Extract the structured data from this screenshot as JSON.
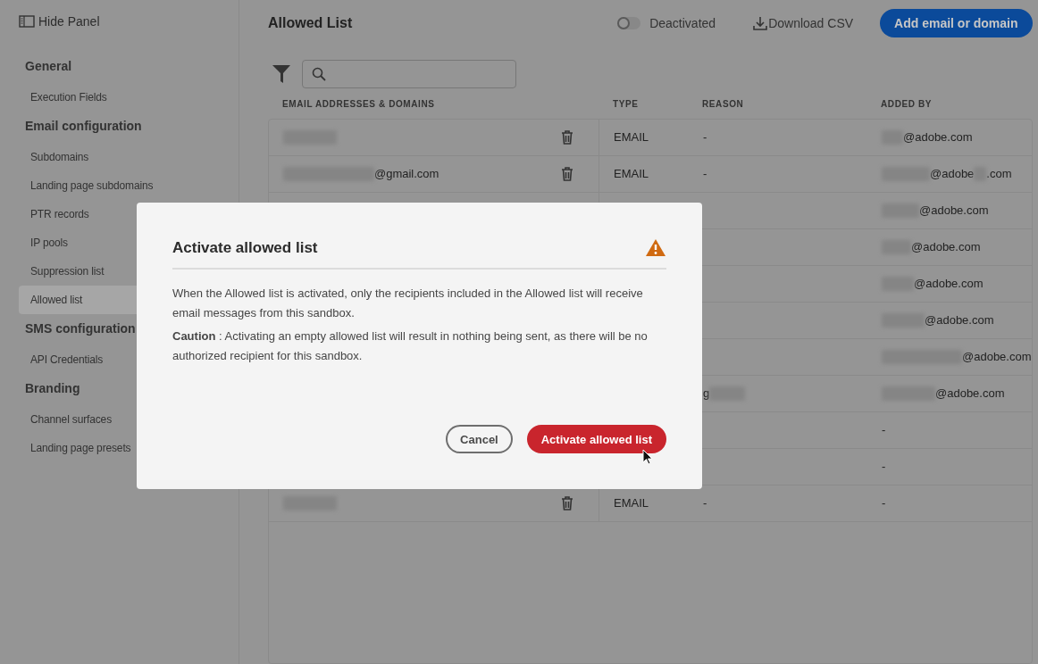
{
  "sidebar": {
    "toggle_label": "Hide Panel",
    "sections": [
      {
        "title": "General",
        "items": [
          {
            "label": "Execution Fields",
            "selected": false
          }
        ]
      },
      {
        "title": "Email configuration",
        "items": [
          {
            "label": "Subdomains",
            "selected": false
          },
          {
            "label": "Landing page subdomains",
            "selected": false
          },
          {
            "label": "PTR records",
            "selected": false
          },
          {
            "label": "IP pools",
            "selected": false
          },
          {
            "label": "Suppression list",
            "selected": false
          },
          {
            "label": "Allowed list",
            "selected": true
          }
        ]
      },
      {
        "title": "SMS configuration",
        "items": [
          {
            "label": "API Credentials",
            "selected": false
          }
        ]
      },
      {
        "title": "Branding",
        "items": [
          {
            "label": "Channel surfaces",
            "selected": false
          },
          {
            "label": "Landing page presets",
            "selected": false
          }
        ]
      }
    ]
  },
  "header": {
    "title": "Allowed List",
    "toggle": {
      "label": "Deactivated",
      "on": false
    },
    "download_label": "Download CSV",
    "add_button": "Add email or domain"
  },
  "table": {
    "columns": [
      "EMAIL ADDRESSES & DOMAINS",
      "TYPE",
      "REASON",
      "ADDED BY"
    ],
    "rows": [
      {
        "email": [
          {
            "kind": "blur"
          }
        ],
        "type": "EMAIL",
        "reason": "-",
        "added_by": [
          {
            "kind": "blur"
          },
          {
            "kind": "text",
            "text": "@adobe.com"
          }
        ]
      },
      {
        "email": [
          {
            "kind": "blur"
          },
          {
            "kind": "text",
            "text": "@gmail.com"
          }
        ],
        "type": "EMAIL",
        "reason": "-",
        "added_by": [
          {
            "kind": "blur"
          },
          {
            "kind": "text",
            "text": "@adobe"
          },
          {
            "kind": "blur"
          },
          {
            "kind": "text",
            "text": ".com"
          }
        ]
      },
      {
        "added_by": [
          {
            "kind": "blur"
          },
          {
            "kind": "text",
            "text": "@adobe.com"
          }
        ]
      },
      {
        "added_by": [
          {
            "kind": "blur"
          },
          {
            "kind": "text",
            "text": "@adobe.com"
          }
        ]
      },
      {
        "added_by": [
          {
            "kind": "blur"
          },
          {
            "kind": "text",
            "text": "@adobe.com"
          }
        ]
      },
      {
        "added_by": [
          {
            "kind": "blur"
          },
          {
            "kind": "text",
            "text": "@adobe.com"
          }
        ]
      },
      {
        "added_by": [
          {
            "kind": "blur"
          },
          {
            "kind": "text",
            "text": "@adobe.com"
          }
        ]
      },
      {
        "reason_parts": [
          {
            "kind": "text",
            "text": "g"
          },
          {
            "kind": "blur"
          }
        ],
        "added_by": [
          {
            "kind": "blur"
          },
          {
            "kind": "text",
            "text": "@adobe.com"
          }
        ]
      },
      {
        "added_by": [
          {
            "kind": "text",
            "text": "-"
          }
        ]
      },
      {
        "added_by": [
          {
            "kind": "text",
            "text": "-"
          }
        ]
      },
      {
        "email": [
          {
            "kind": "blur"
          }
        ],
        "type": "EMAIL",
        "reason": "-",
        "added_by": [
          {
            "kind": "text",
            "text": "-"
          }
        ]
      }
    ]
  },
  "dialog": {
    "title": "Activate allowed list",
    "paragraphs": [
      "When the Allowed list is activated, only the recipients included in the Allowed list will receive email messages from this sandbox.",
      "**Caution** : Activating an empty allowed list will result in nothing being sent, as there will be no authorized recipient for this sandbox."
    ],
    "cancel": "Cancel",
    "confirm": "Activate allowed list"
  }
}
